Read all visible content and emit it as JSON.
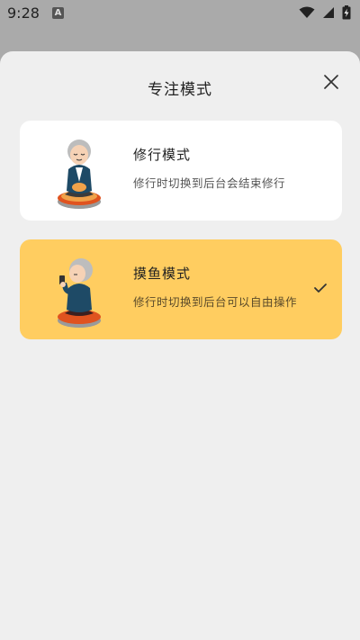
{
  "status_bar": {
    "time": "9:28",
    "notification_glyph": "A"
  },
  "sheet": {
    "title": "专注模式",
    "close_icon": "close-icon",
    "modes": [
      {
        "title": "修行模式",
        "description": "修行时切换到后台会结束修行",
        "selected": false,
        "illustration": "monk-meditating"
      },
      {
        "title": "摸鱼模式",
        "description": "修行时切换到后台可以自由操作",
        "selected": true,
        "illustration": "monk-with-phone"
      }
    ]
  },
  "colors": {
    "selected_card": "#ffcd60",
    "card": "#ffffff",
    "sheet_bg": "#efefef",
    "scrim": "#aaaaaa"
  }
}
